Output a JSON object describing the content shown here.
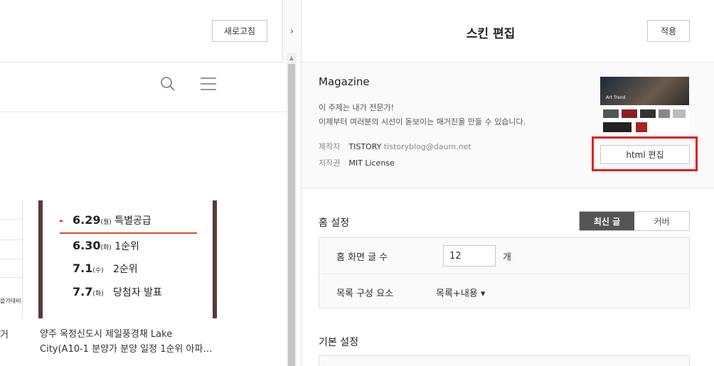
{
  "left_toolbar": {
    "refresh_label": "새로고침",
    "collapse_glyph": "›"
  },
  "preview": {
    "search_icon": "search-icon",
    "menu_icon": "hamburger-menu-icon",
    "left_card_tag": "을가대비",
    "left_card_caption": "거",
    "schedule": [
      {
        "date": "6.29",
        "weekday": "(월)",
        "label": "특별공급"
      },
      {
        "date": "6.30",
        "weekday": "(화)",
        "label": "1순위"
      },
      {
        "date": "7.1",
        "weekday": "(수)",
        "label": "2순위"
      },
      {
        "date": "7.7",
        "weekday": "(화)",
        "label": "당첨자 발표"
      }
    ],
    "card_caption": "양주 옥정신도시 제일풍경채 Lake City(A10-1 분양가 분양 일정 1순위 아파…"
  },
  "right": {
    "title": "스킨 편집",
    "apply_label": "적용",
    "skin": {
      "name": "Magazine",
      "desc_line1": "이 주제는 내가 전문가!",
      "desc_line2": "이제부터 여러분의 시선이 돋보이는 매거진을 만들 수 있습니다.",
      "maker_key": "제작자",
      "maker_value": "TISTORY",
      "maker_email": "tistoryblog@daum.net",
      "license_key": "저작권",
      "license_value": "MIT License",
      "thumb_text": "Art Trend",
      "html_edit_label": "html 편집"
    },
    "home": {
      "section_title": "홈 설정",
      "tab_latest": "최신 글",
      "tab_cover": "커버",
      "post_count_label": "홈 화면 글 수",
      "post_count_value": "12",
      "post_count_unit": "개",
      "list_label": "목록 구성 요소",
      "list_value": "목록+내용 ▾"
    },
    "basic": {
      "section_title": "기본 설정"
    }
  }
}
